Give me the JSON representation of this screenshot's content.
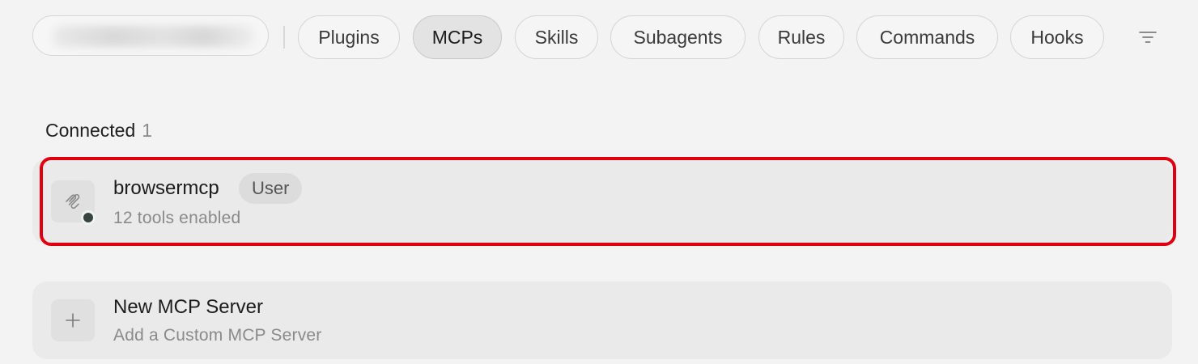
{
  "tabs": [
    {
      "label": "Plugins",
      "active": false
    },
    {
      "label": "MCPs",
      "active": true
    },
    {
      "label": "Skills",
      "active": false
    },
    {
      "label": "Subagents",
      "active": false
    },
    {
      "label": "Rules",
      "active": false
    },
    {
      "label": "Commands",
      "active": false
    },
    {
      "label": "Hooks",
      "active": false
    }
  ],
  "section": {
    "title": "Connected",
    "count": "1"
  },
  "servers": [
    {
      "name": "browsermcp",
      "badge": "User",
      "subtitle": "12 tools enabled",
      "status_color": "#364541",
      "icon": "mcp-server-icon"
    }
  ],
  "new_server": {
    "title": "New MCP Server",
    "subtitle": "Add a Custom MCP Server",
    "icon": "plus-icon"
  },
  "colors": {
    "highlight": "#e1000f",
    "active_tab_bg": "#e3e3e3"
  }
}
